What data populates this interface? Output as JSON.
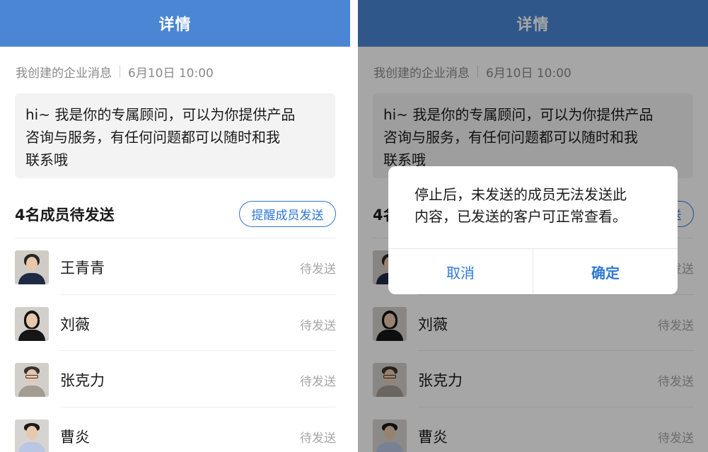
{
  "header": {
    "title": "详情"
  },
  "meta": {
    "source": "我创建的企业消息",
    "datetime": "6月10日 10:00"
  },
  "message": {
    "lines": [
      "hi~ 我是你的专属顾问，可以为你提供产品",
      "咨询与服务，有任何问题都可以随时和我",
      "联系哦"
    ]
  },
  "pending": {
    "title": "4名成员待发送",
    "remind_label": "提醒成员发送"
  },
  "members": [
    {
      "name": "王青青",
      "status": "待发送"
    },
    {
      "name": "刘薇",
      "status": "待发送"
    },
    {
      "name": "张克力",
      "status": "待发送"
    },
    {
      "name": "曹炎",
      "status": "待发送"
    }
  ],
  "dialog": {
    "lines": [
      "停止后，未发送的成员无法发送此",
      "内容，已发送的客户可正常查看。"
    ],
    "cancel_label": "取消",
    "confirm_label": "确定"
  },
  "colors": {
    "header": "#4a86d4",
    "accent": "#2f78d4",
    "status_gray": "#a6a6a6"
  }
}
